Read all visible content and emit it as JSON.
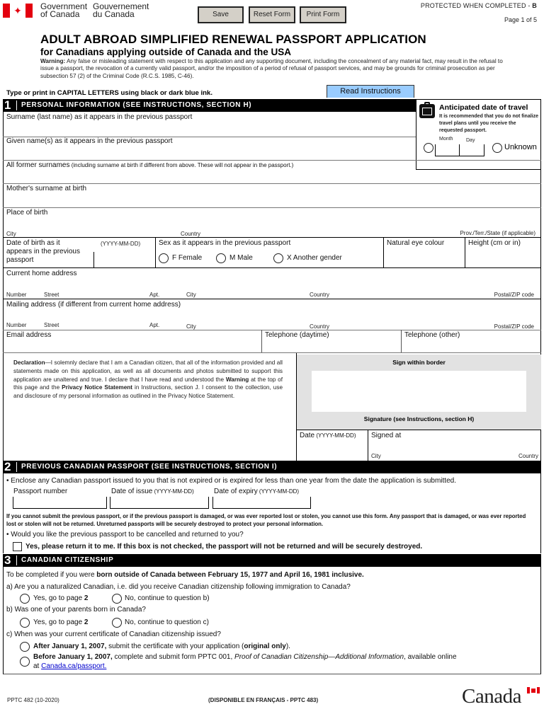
{
  "header": {
    "gov_en_line1": "Government",
    "gov_en_line2": "of Canada",
    "gov_fr_line1": "Gouvernement",
    "gov_fr_line2": "du Canada",
    "buttons": {
      "save": "Save",
      "reset": "Reset Form",
      "print": "Print Form"
    },
    "protected": "PROTECTED WHEN COMPLETED - ",
    "protected_level": "B",
    "page": "Page 1 of 5",
    "title": "ADULT ABROAD SIMPLIFIED RENEWAL PASSPORT APPLICATION",
    "subtitle": "for Canadians applying outside of Canada and the USA",
    "warning_label": "Warning:",
    "warning_text": " Any false or misleading statement with respect to this application and any supporting document, including the concealment of any material fact, may result in the refusal to issue a passport, the revocation of a currently valid passport, and/or the imposition of a period of refusal of passport services, and may be grounds for criminal prosecution as per subsection 57 (2) of the Criminal Code (R.C.S. 1985, C-46).",
    "type_print": "Type or print in CAPITAL LETTERS using black or dark blue ink.",
    "read_instructions": "Read Instructions"
  },
  "section1": {
    "number": "1",
    "title": "PERSONAL INFORMATION (SEE INSTRUCTIONS, SECTION H)",
    "surname": "Surname (last name) as it appears in the previous passport",
    "given": "Given name(s) as it appears in the previous passport",
    "former": "All former surnames",
    "former_note": " (including surname at birth if different from above. These will not appear in the passport.)",
    "mother": "Mother's surname at birth",
    "place_birth": "Place of birth",
    "city": "City",
    "country": "Country",
    "prov": "Prov./Terr./State (if applicable)",
    "dob_l1": "Date of birth as it",
    "dob_l2": "appears in the previous",
    "dob_l3": "passport",
    "dob_fmt": "(YYYY-MM-DD)",
    "sex": "Sex as it appears in the previous passport",
    "sex_options": [
      "F  Female",
      "M  Male",
      "X  Another gender"
    ],
    "eye": "Natural eye colour",
    "height": "Height (cm or in)",
    "home_addr": "Current home address",
    "mail_addr": "Mailing address (if different from current home address)",
    "addr_parts": {
      "number": "Number",
      "street": "Street",
      "apt": "Apt.",
      "city": "City",
      "country": "Country",
      "postal": "Postal/ZIP code"
    },
    "email": "Email address",
    "tel_day": "Telephone (daytime)",
    "tel_other": "Telephone (other)",
    "travel": {
      "title": "Anticipated date of travel",
      "note": "It is recommended that you do not finalize travel plans until you receive the requested passport.",
      "month": "Month",
      "day": "Day",
      "unknown": "Unknown"
    },
    "declaration": {
      "label": "Declaration",
      "part1": "—I solemnly declare that I am a Canadian citizen, that all of the information provided and all statements made on this application, as well as all documents and photos submitted to support this application are unaltered and true. I declare that I have read and understood the ",
      "warning": "Warning",
      "part2": " at the top of this page and the ",
      "privacy": "Privacy Notice Statement",
      "part3": " in Instructions, section J. I consent to the collection, use and disclosure of my personal information as outlined in the Privacy Notice Statement."
    },
    "sign_within": "Sign within border",
    "signature": "Signature (see Instructions, section H)",
    "date": "Date",
    "date_fmt": " (YYYY-MM-DD)",
    "signed_at": "Signed at",
    "city2": "City",
    "country2": "Country"
  },
  "section2": {
    "number": "2",
    "title": "PREVIOUS CANADIAN PASSPORT (SEE INSTRUCTIONS, SECTION I)",
    "enclose": "• Enclose any Canadian passport issued to you that is not expired or is expired for less than one year from the date the application is submitted.",
    "passport_number": "Passport number",
    "date_issue": "Date of issue",
    "date_expiry": "Date of expiry",
    "fmt": " (YYYY-MM-DD)",
    "cannot": "If you cannot submit the previous passport, or if the previous passport is damaged, or was ever reported lost or stolen, you cannot use this form. Any passport that is damaged, or was ever reported lost or stolen will not be returned. Unreturned passports will be securely destroyed to protect your personal information.",
    "would_like": "• Would you like the previous passport to be cancelled and returned to you?",
    "yes_return": "Yes, please return it to me. If this box is not checked, the passport will not be returned and will be securely destroyed."
  },
  "section3": {
    "number": "3",
    "title": "CANADIAN CITIZENSHIP",
    "intro_pre": "To be completed if you were ",
    "intro_bold": "born outside of Canada between February 15, 1977 and April 16, 1981 inclusive.",
    "qa": "a)  Are you a naturalized Canadian, i.e. did you receive Canadian citizenship following immigration to Canada?",
    "qb": "b)  Was one of your parents born in Canada?",
    "qc": "c)  When was your current certificate of Canadian citizenship issued?",
    "yes_pre": "Yes, go to page ",
    "yes_page": "2",
    "no_b": "No, continue to question b)",
    "no_c": "No, continue to question c)",
    "after_bold": "After January 1, 2007,",
    "after_text": " submit the certificate with your application (",
    "after_orig": "original only",
    "after_end": ").",
    "before_bold": "Before January 1, 2007,",
    "before_text": " complete and submit form PPTC 001, ",
    "before_italic": "Proof of Canadian Citizenship—Additional Information",
    "before_end": ", available online",
    "at": "at ",
    "link": "Canada.ca/passport."
  },
  "footer": {
    "form_id": "PPTC 482 (10-2020)",
    "french": "(DISPONIBLE EN FRANÇAIS - PPTC 483)",
    "wordmark": "Canada"
  }
}
